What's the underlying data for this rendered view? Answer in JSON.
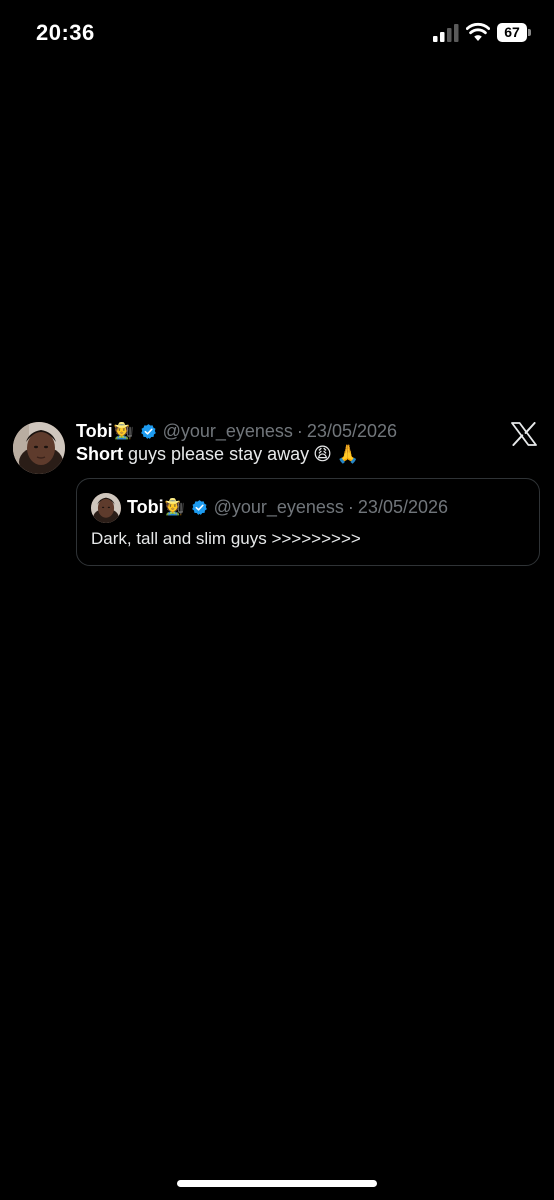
{
  "status_bar": {
    "time": "20:36",
    "battery_level": "67",
    "icons": [
      "signal-icon",
      "wifi-icon",
      "battery-icon"
    ]
  },
  "tweet": {
    "author_name": "Tobi",
    "author_emoji": "🧑‍🌾",
    "handle": "@your_eyeness",
    "separator": "·",
    "date": "23/05/2026",
    "text_bold": "Short",
    "text_rest": " guys please stay away",
    "text_emojis": "😩 🙏",
    "verified_color": "#1d9bf0",
    "brand_icon": "x-logo-icon"
  },
  "quoted_tweet": {
    "author_name": "Tobi",
    "author_emoji": "🧑‍🌾",
    "handle": "@your_eyeness",
    "separator": "·",
    "date": "23/05/2026",
    "text": "Dark, tall and slim guys >>>>>>>>>"
  },
  "colors": {
    "background": "#000000",
    "text_primary": "#e7e9ea",
    "text_secondary": "#71767b",
    "border": "#2f3336"
  }
}
